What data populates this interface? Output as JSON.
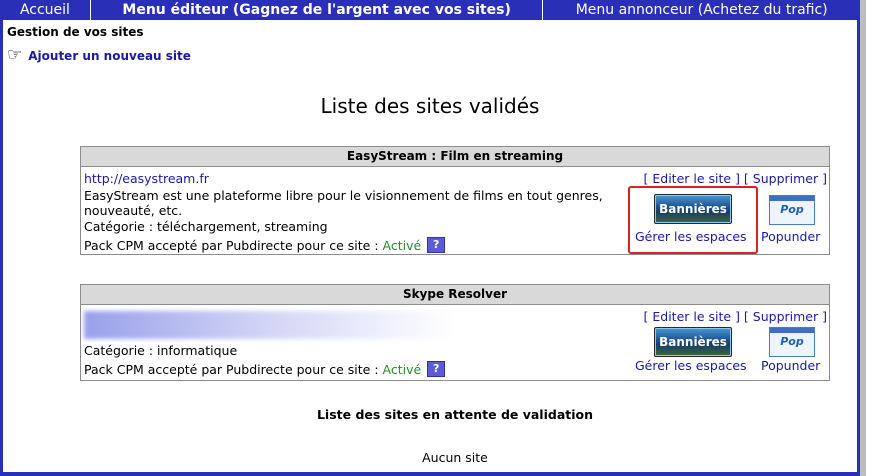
{
  "nav": {
    "home": "Accueil",
    "editor_menu": "Menu éditeur (Gagnez de l'argent avec vos sites)",
    "advertiser_menu": "Menu annonceur (Achetez du trafic)"
  },
  "sites_section": {
    "title": "Gestion de vos sites",
    "add_link": "Ajouter un nouveau site",
    "validated_title": "Liste des sites validés"
  },
  "sites": [
    {
      "name": "EasyStream : Film en streaming",
      "url": "http://easystream.fr",
      "description": "EasyStream est une plateforme libre pour le visionnement de films en tout genres, nouveauté, etc.",
      "category": "Catégorie : téléchargement, streaming",
      "pack_label": "Pack CPM accepté par Pubdirecte pour ce site :",
      "pack_status": "Activé",
      "edit_label": "Editer le site",
      "delete_label": "Supprimer",
      "banner_button": "Bannières",
      "manage_spaces": "Gérer les espaces",
      "pop_button": "Pop",
      "popunder": "Popunder"
    },
    {
      "name": "Skype Resolver",
      "url": "",
      "description": "",
      "category": "Catégorie : informatique",
      "pack_label": "Pack CPM accepté par Pubdirecte pour ce site :",
      "pack_status": "Activé",
      "edit_label": "Editer le site",
      "delete_label": "Supprimer",
      "banner_button": "Bannières",
      "manage_spaces": "Gérer les espaces",
      "pop_button": "Pop",
      "popunder": "Popunder"
    }
  ],
  "pending": {
    "title": "Liste des sites en attente de validation",
    "empty": "Aucun site"
  },
  "icons": {
    "hand": "pointing-hand-icon",
    "help": "help-icon"
  },
  "colors": {
    "nav_bg": "#2a2fb8",
    "link": "#1a1aa6",
    "active": "#2a8a2a",
    "highlight": "#e02020"
  }
}
